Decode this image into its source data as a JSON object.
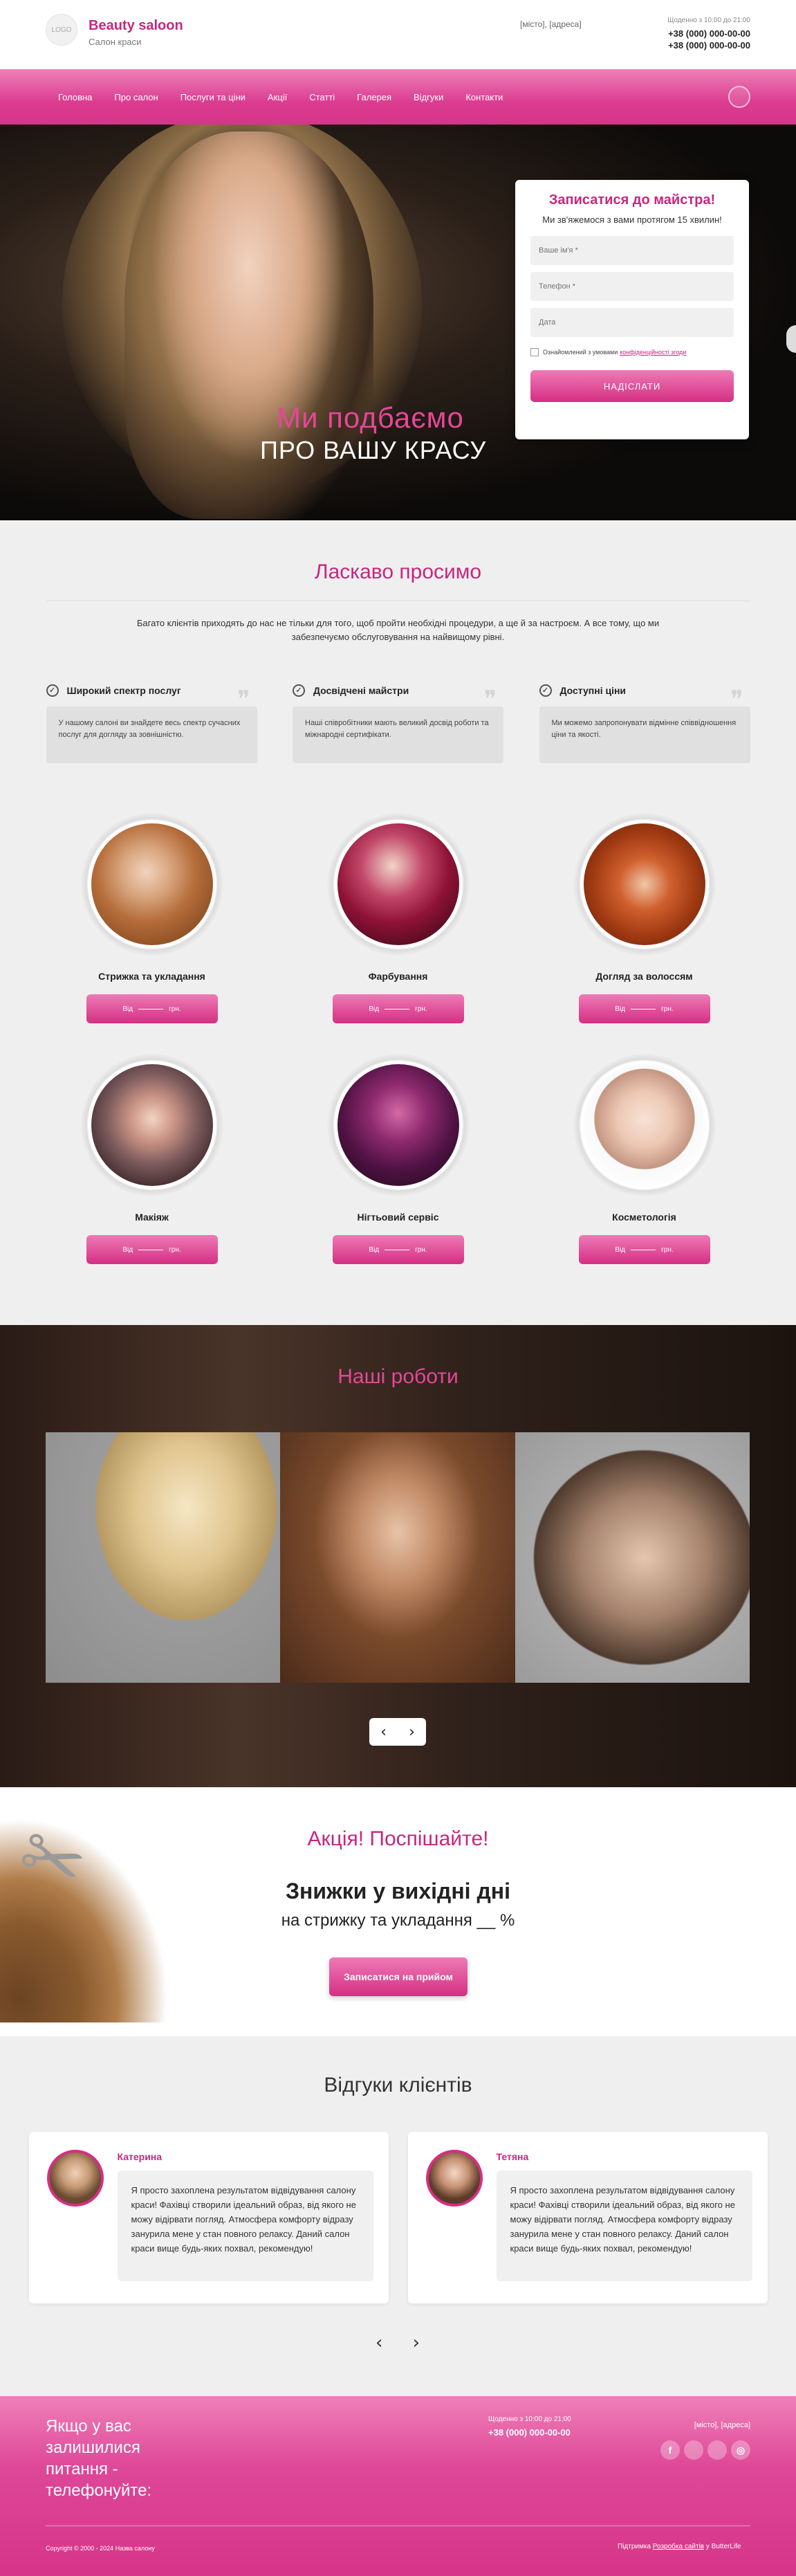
{
  "header": {
    "logo": "LOGO",
    "brand": "Beauty saloon",
    "subtitle": "Салон краси",
    "address": "[місто], [адреса]",
    "hours": "Щоденно з 10:00 до 21:00",
    "phone1": "+38 (000) 000-00-00",
    "phone2": "+38 (000) 000-00-00"
  },
  "nav": [
    "Головна",
    "Про салон",
    "Послуги та ціни",
    "Акції",
    "Статті",
    "Галерея",
    "Відгуки",
    "Контакти"
  ],
  "hero": {
    "line1": "Ми подбаємо",
    "line2": "ПРО ВАШУ КРАСУ"
  },
  "form": {
    "title": "Записатися до майстра!",
    "subtitle": "Ми зв'яжемося з вами протягом 15 хвилин!",
    "name_placeholder": "Ваше ім'я *",
    "phone_placeholder": "Телефон *",
    "date_placeholder": "Дата",
    "agree_text": "Ознайомлений з умовами",
    "agree_link": "конфіденційності згоди",
    "submit": "НАДІСЛАТИ"
  },
  "welcome": {
    "title": "Ласкаво просимо",
    "text": "Багато клієнтів приходять до нас не тільки для того, щоб пройти необхідні процедури, а ще й за настроєм. А все тому, що ми забезпечуємо обслуговування на найвищому рівні."
  },
  "features": [
    {
      "title": "Широкий спектр послуг",
      "text": "У нашому салоні ви знайдете весь спектр сучасних послуг для догляду за зовнішністю."
    },
    {
      "title": "Досвідчені майстри",
      "text": "Наші співробітники мають великий досвід роботи та міжнародні сертифікати."
    },
    {
      "title": "Доступні ціни",
      "text": "Ми можемо запропонувати відмінне співвідношення ціни та якості."
    }
  ],
  "services": [
    {
      "name": "Стрижка та укладання",
      "from": "Від",
      "currency": "грн."
    },
    {
      "name": "Фарбування",
      "from": "Від",
      "currency": "грн."
    },
    {
      "name": "Догляд за волоссям",
      "from": "Від",
      "currency": "грн."
    },
    {
      "name": "Макіяж",
      "from": "Від",
      "currency": "грн."
    },
    {
      "name": "Нігтьовий сервіс",
      "from": "Від",
      "currency": "грн."
    },
    {
      "name": "Косметологія",
      "from": "Від",
      "currency": "грн."
    }
  ],
  "works": {
    "title": "Наші роботи",
    "prev": "‹",
    "next": "›"
  },
  "promo": {
    "title": "Акція! Поспішайте!",
    "big": "Знижки у вихідні дні",
    "mid": "на стрижку та укладання __ %",
    "button": "Записатися на прийом"
  },
  "reviews": {
    "title": "Відгуки клієнтів",
    "items": [
      {
        "name": "Катерина",
        "text": "Я просто захоплена результатом відвідування салону краси! Фахівці створили ідеальний образ, від якого не можу відірвати погляд. Атмосфера комфорту відразу занурила мене у стан повного релаксу. Даний салон краси вище будь-яких похвал, рекомендую!"
      },
      {
        "name": "Тетяна",
        "text": "Я просто захоплена результатом відвідування салону краси! Фахівці створили ідеальний образ, від якого не можу відірвати погляд. Атмосфера комфорту відразу занурила мене у стан повного релаксу. Даний салон краси вище будь-яких похвал, рекомендую!"
      }
    ],
    "prev": "‹",
    "next": "›"
  },
  "footer": {
    "callout": "Якщо у вас залишилися питання - телефонуйте:",
    "hours": "Щоденно з 10:00 до 21:00",
    "phone": "+38 (000) 000-00-00",
    "address": "[місто], [адреса]",
    "copyright": "Copyright © 2000 - 2024 Назва салону",
    "dev_label": "Підтримка",
    "dev_link": "Розробка сайтів",
    "dev_suffix": "у ButterLife",
    "socials": [
      "f",
      "",
      "",
      "◎"
    ]
  },
  "colors": {
    "accent": "#c8267f",
    "accent_light": "#ee7ab6",
    "hero_text": "#e54797"
  },
  "icons": [
    "search-icon",
    "check-icon",
    "quote-icon",
    "scissors-icon",
    "facebook-icon",
    "instagram-icon",
    "chevron-left-icon",
    "chevron-right-icon"
  ]
}
